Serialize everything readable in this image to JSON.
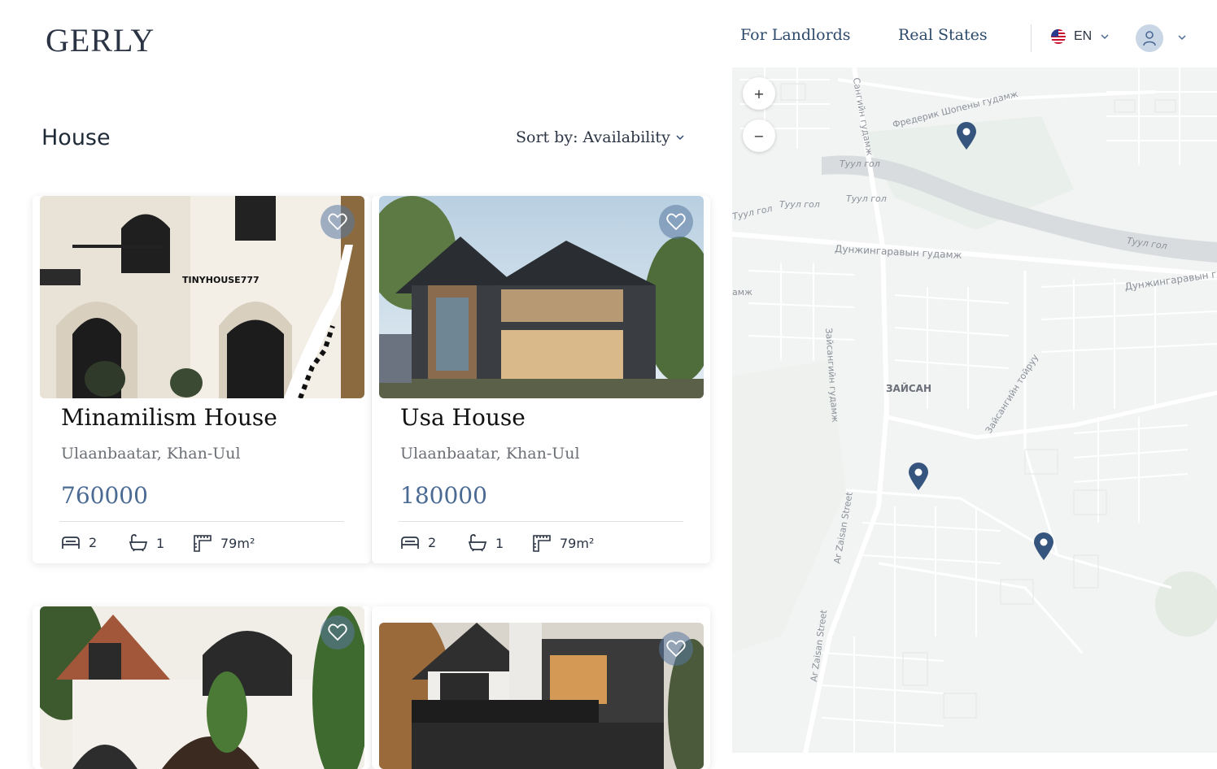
{
  "header": {
    "logo": "GERLY",
    "nav": [
      "For Landlords",
      "Real States"
    ],
    "language": "EN",
    "flag_icon": "us-flag-icon",
    "colors": {
      "nav_text": "#2c4a6b",
      "accent": "#4b6a93",
      "pin": "#35557f"
    }
  },
  "listing": {
    "title": "House",
    "sort_label": "Sort by: Availability",
    "cards": [
      {
        "title": "Minamilism House",
        "location": "Ulaanbaatar, Khan-Uul",
        "price": "760000",
        "beds": "2",
        "baths": "1",
        "area": "79m²",
        "image_label": "TINYHOUSE777"
      },
      {
        "title": "Usa House",
        "location": "Ulaanbaatar, Khan-Uul",
        "price": "180000",
        "beds": "2",
        "baths": "1",
        "area": "79m²"
      },
      {
        "title": "",
        "location": "",
        "price": ""
      },
      {
        "title": "",
        "location": "",
        "price": ""
      }
    ]
  },
  "map": {
    "zoom_in": "+",
    "zoom_out": "−",
    "labels": [
      "Сангийн гудамж",
      "Фредерик Шопены гудамж",
      "Туул гол",
      "Туул гол",
      "Туул гол",
      "Туул гол",
      "Туул гол",
      "Дунжингаравын гудамж",
      "Дунжингаравын г",
      "амж",
      "Зайсангийн гудамж",
      "ЗАЙСАН",
      "Зайсангийн тойруу",
      "Ar Zaisan Street",
      "Ar Zaisan Street"
    ],
    "pin_count": 3
  }
}
